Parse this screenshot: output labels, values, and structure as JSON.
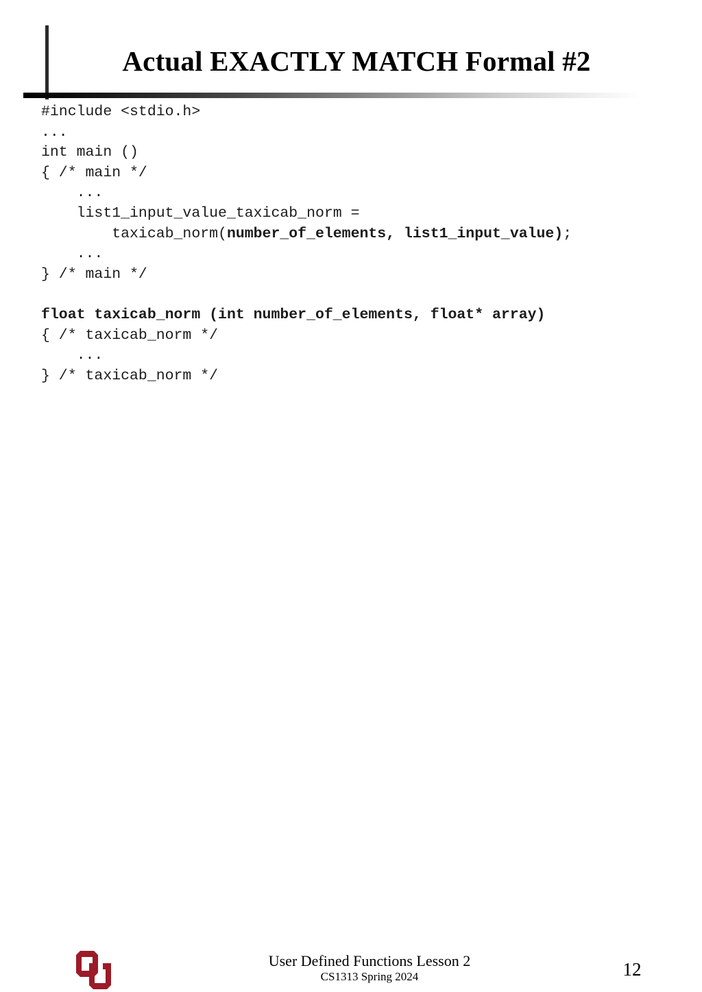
{
  "slide": {
    "title": "Actual EXACTLY MATCH Formal #2",
    "page_number": "12",
    "background_color": "#ffffff",
    "title_color": "#000000",
    "rule_color": "#000000",
    "code_color": "#1c1c1c",
    "logo_color": "#9c1b28"
  },
  "code": {
    "lines": [
      {
        "indent": "",
        "plain_before": "#include <stdio.h>",
        "bold": "",
        "plain_after": ""
      },
      {
        "indent": "",
        "plain_before": "...",
        "bold": "",
        "plain_after": ""
      },
      {
        "indent": "",
        "plain_before": "int main ()",
        "bold": "",
        "plain_after": ""
      },
      {
        "indent": "",
        "plain_before": "{ /* main */",
        "bold": "",
        "plain_after": ""
      },
      {
        "indent": "    ",
        "plain_before": "...",
        "bold": "",
        "plain_after": ""
      },
      {
        "indent": "    ",
        "plain_before": "list1_input_value_taxicab_norm =",
        "bold": "",
        "plain_after": ""
      },
      {
        "indent": "        ",
        "plain_before": "taxicab_norm(",
        "bold": "number_of_elements, list1_input_value)",
        "plain_after": ";"
      },
      {
        "indent": "    ",
        "plain_before": "...",
        "bold": "",
        "plain_after": ""
      },
      {
        "indent": "",
        "plain_before": "} /* main */",
        "bold": "",
        "plain_after": ""
      },
      {
        "indent": "",
        "plain_before": "",
        "bold": "",
        "plain_after": ""
      },
      {
        "indent": "",
        "plain_before": "",
        "bold": "float taxicab_norm (int number_of_elements, float* array)",
        "plain_after": ""
      },
      {
        "indent": "",
        "plain_before": "{ /* taxicab_norm */",
        "bold": "",
        "plain_after": ""
      },
      {
        "indent": "    ",
        "plain_before": "...",
        "bold": "",
        "plain_after": ""
      },
      {
        "indent": "",
        "plain_before": "} /* taxicab_norm */",
        "bold": "",
        "plain_after": ""
      }
    ]
  },
  "footer": {
    "lesson": "User Defined Functions Lesson 2",
    "course": "CS1313 Spring 2024",
    "logo_name": "ou-logo"
  }
}
